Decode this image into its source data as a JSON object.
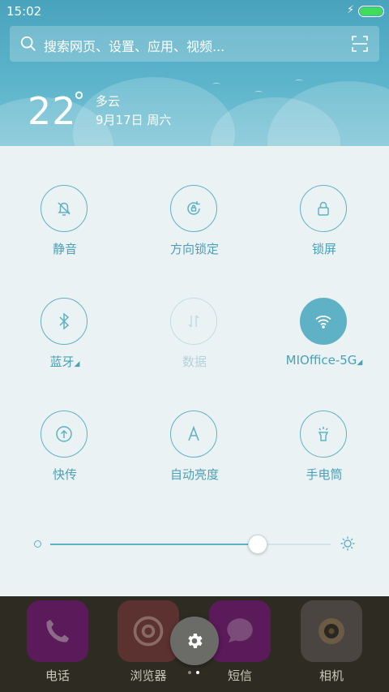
{
  "status": {
    "time": "15:02",
    "battery_level": 1.0
  },
  "search": {
    "placeholder": "搜索网页、设置、应用、视频..."
  },
  "weather": {
    "temperature": "22",
    "degree_symbol": "°",
    "condition": "多云",
    "date": "9月17日 周六"
  },
  "toggles": [
    {
      "label": "静音",
      "icon": "bell-off-icon",
      "state": "off"
    },
    {
      "label": "方向锁定",
      "icon": "rotation-lock-icon",
      "state": "off"
    },
    {
      "label": "锁屏",
      "icon": "lock-icon",
      "state": "off"
    },
    {
      "label": "蓝牙",
      "suffix": "◢",
      "icon": "bluetooth-icon",
      "state": "off"
    },
    {
      "label": "数据",
      "icon": "mobile-data-icon",
      "state": "disabled"
    },
    {
      "label": "MIOffice-5G",
      "suffix": "◢",
      "icon": "wifi-icon",
      "state": "on"
    },
    {
      "label": "快传",
      "icon": "transfer-icon",
      "state": "off"
    },
    {
      "label": "自动亮度",
      "icon": "auto-brightness-icon",
      "state": "off"
    },
    {
      "label": "手电筒",
      "icon": "flashlight-icon",
      "state": "off"
    }
  ],
  "brightness": {
    "level": 0.74
  },
  "dock": {
    "apps": [
      {
        "label": "电话",
        "icon": "phone-icon",
        "color": "#5b1a5a"
      },
      {
        "label": "浏览器",
        "icon": "browser-icon",
        "color": "#5b3230"
      },
      {
        "label": "短信",
        "icon": "message-icon",
        "color": "#5b1a5a"
      },
      {
        "label": "相机",
        "icon": "camera-icon",
        "color": "#4a4540"
      }
    ],
    "page_count": 2,
    "current_page": 2
  },
  "colors": {
    "accent": "#5fb1c6",
    "panel_bg": "#ebf2f4",
    "header_bg": "#4aa3bd"
  }
}
